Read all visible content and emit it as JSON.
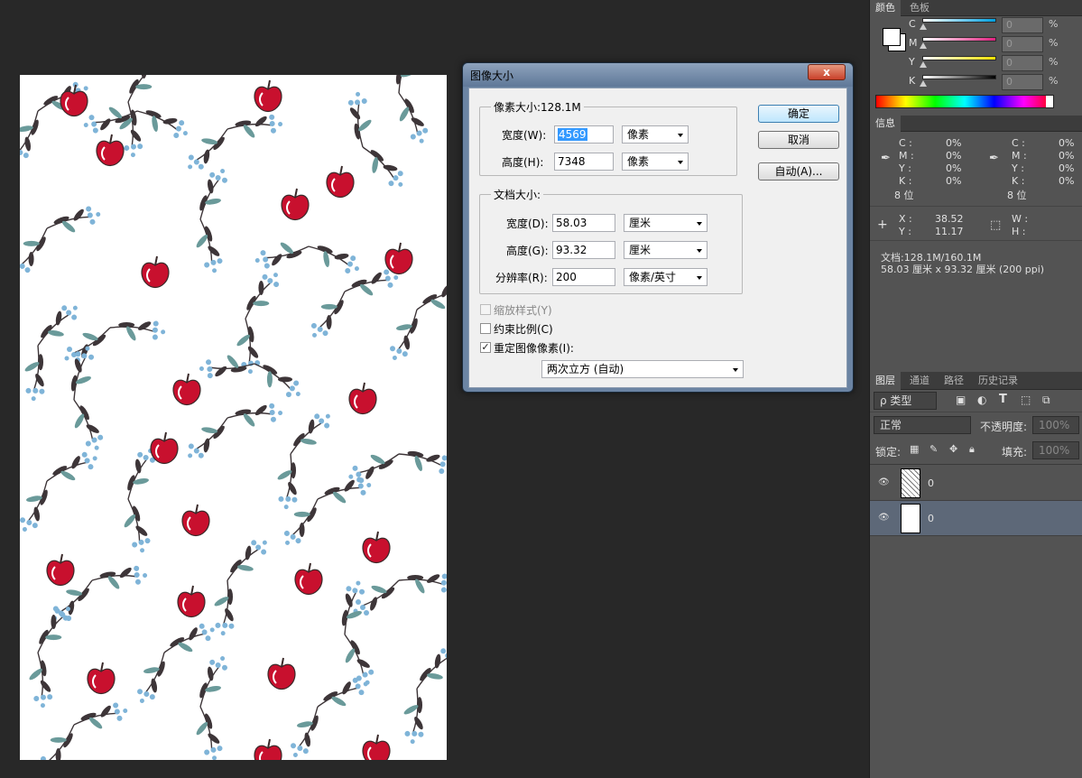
{
  "color_panel": {
    "tabs": [
      "颜色",
      "色板"
    ],
    "channels": [
      {
        "label": "C",
        "value": "0",
        "unit": "%",
        "color": "#00a0e0"
      },
      {
        "label": "M",
        "value": "0",
        "unit": "%",
        "color": "#e0207f"
      },
      {
        "label": "Y",
        "value": "0",
        "unit": "%",
        "color": "#f0e000"
      },
      {
        "label": "K",
        "value": "0",
        "unit": "%",
        "color": "#000000"
      }
    ]
  },
  "info_panel": {
    "tab": "信息",
    "left": {
      "c": "C :",
      "m": "M :",
      "y": "Y :",
      "k": "K :",
      "cv": "0%",
      "mv": "0%",
      "yv": "0%",
      "kv": "0%",
      "bits": "8 位"
    },
    "right": {
      "c": "C :",
      "m": "M :",
      "y": "Y :",
      "k": "K :",
      "cv": "0%",
      "mv": "0%",
      "yv": "0%",
      "kv": "0%",
      "bits": "8 位"
    },
    "x_label": "X :",
    "x_value": "38.52",
    "y_label": "Y :",
    "y_value": "11.17",
    "w_label": "W :",
    "h_label": "H :",
    "doc_line": "文档:128.1M/160.1M",
    "size_line": "58.03 厘米 x 93.32 厘米 (200 ppi)"
  },
  "layers_panel": {
    "tabs": [
      "图层",
      "通道",
      "路径",
      "历史记录"
    ],
    "filter_label": "ρ 类型",
    "blend_mode": "正常",
    "opacity_label": "不透明度:",
    "opacity_value": "100%",
    "lock_label": "锁定:",
    "fill_label": "填充:",
    "fill_value": "100%",
    "layers": [
      {
        "name": "0"
      },
      {
        "name": "0"
      }
    ]
  },
  "dialog": {
    "title": "图像大小",
    "close": "x",
    "pixel_dims_label": "像素大小:128.1M",
    "px_width_label": "宽度(W):",
    "px_width_value": "4569",
    "px_width_unit": "像素",
    "px_height_label": "高度(H):",
    "px_height_value": "7348",
    "px_height_unit": "像素",
    "doc_size_label": "文档大小:",
    "doc_width_label": "宽度(D):",
    "doc_width_value": "58.03",
    "doc_width_unit": "厘米",
    "doc_height_label": "高度(G):",
    "doc_height_value": "93.32",
    "doc_height_unit": "厘米",
    "resolution_label": "分辨率(R):",
    "resolution_value": "200",
    "resolution_unit": "像素/英寸",
    "scale_styles_label": "缩放样式(Y)",
    "constrain_label": "约束比例(C)",
    "resample_label": "重定图像像素(I):",
    "resample_method": "两次立方 (自动)",
    "ok_label": "确定",
    "cancel_label": "取消",
    "auto_label": "自动(A)..."
  }
}
